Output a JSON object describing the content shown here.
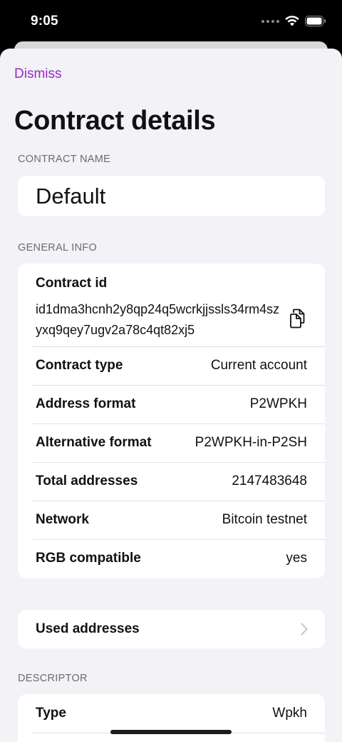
{
  "status": {
    "time": "9:05"
  },
  "nav": {
    "dismiss_label": "Dismiss",
    "title": "Contract details"
  },
  "contract_name": {
    "header": "CONTRACT NAME",
    "value": "Default"
  },
  "general_info": {
    "header": "GENERAL INFO",
    "contract_id_label": "Contract id",
    "contract_id_value": "id1dma3hcnh2y8qp24q5wcrkjjssls34rm4szyxq9qey7ugv2a78c4qt82xj5",
    "rows": [
      {
        "label": "Contract type",
        "value": "Current account"
      },
      {
        "label": "Address format",
        "value": "P2WPKH"
      },
      {
        "label": "Alternative format",
        "value": "P2WPKH-in-P2SH"
      },
      {
        "label": "Total addresses",
        "value": "2147483648"
      },
      {
        "label": "Network",
        "value": "Bitcoin testnet"
      },
      {
        "label": "RGB compatible",
        "value": "yes"
      }
    ]
  },
  "used_addresses": {
    "label": "Used addresses"
  },
  "descriptor": {
    "header": "DESCRIPTOR",
    "rows": [
      {
        "label": "Type",
        "value": "Wpkh"
      }
    ]
  },
  "icons": {
    "copy": "copy-icon",
    "chevron": "chevron-right-icon",
    "wifi": "wifi-icon",
    "battery": "battery-icon"
  },
  "colors": {
    "accent": "#9b27c5",
    "background": "#f2f2f7",
    "card": "#ffffff"
  }
}
